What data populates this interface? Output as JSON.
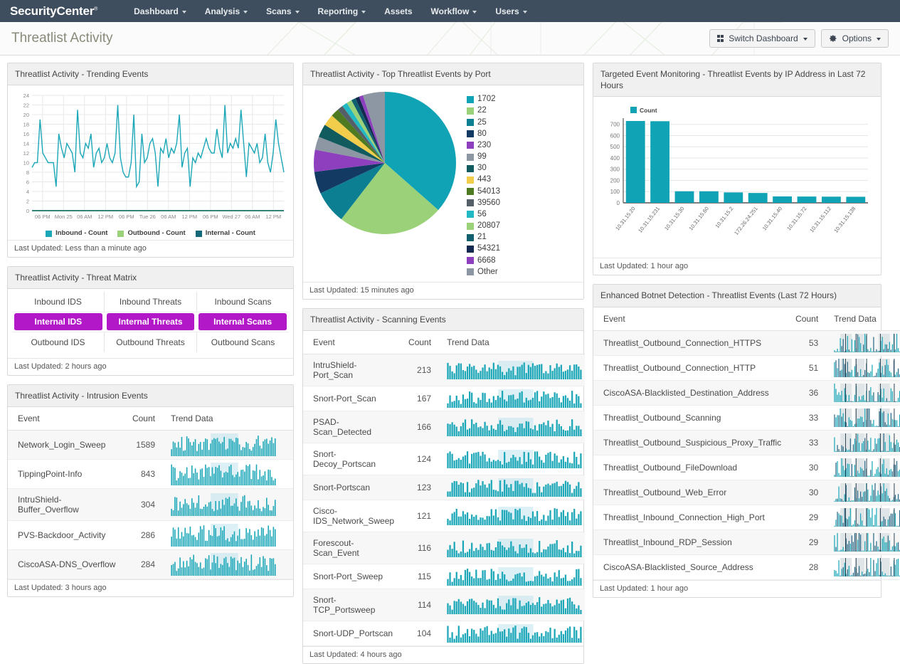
{
  "navbar": {
    "brand": "SecurityCenter",
    "items": [
      {
        "label": "Dashboard",
        "caret": true
      },
      {
        "label": "Analysis",
        "caret": true
      },
      {
        "label": "Scans",
        "caret": true
      },
      {
        "label": "Reporting",
        "caret": true
      },
      {
        "label": "Assets",
        "caret": false
      },
      {
        "label": "Workflow",
        "caret": true
      },
      {
        "label": "Users",
        "caret": true
      }
    ]
  },
  "titlebar": {
    "title": "Threatlist Activity",
    "switch_dashboard_label": "Switch Dashboard",
    "options_label": "Options"
  },
  "colors": {
    "navbar_bg": "#3f4e5e",
    "teal": "#1ba7b8",
    "teal_dark": "#0d7f93",
    "green": "#9bd179",
    "purple": "#b318c8",
    "highlight_band": "#bfe4ec"
  },
  "panels": {
    "trending": {
      "title": "Threatlist Activity - Trending Events",
      "footer": "Last Updated: Less than a minute ago"
    },
    "threat_matrix": {
      "title": "Threatlist Activity - Threat Matrix",
      "footer": "Last Updated: 2 hours ago",
      "rows": [
        [
          {
            "label": "Inbound IDS",
            "active": false
          },
          {
            "label": "Inbound Threats",
            "active": false
          },
          {
            "label": "Inbound Scans",
            "active": false
          }
        ],
        [
          {
            "label": "Internal IDS",
            "active": true
          },
          {
            "label": "Internal Threats",
            "active": true
          },
          {
            "label": "Internal Scans",
            "active": true
          }
        ],
        [
          {
            "label": "Outbound IDS",
            "active": false
          },
          {
            "label": "Outbound Threats",
            "active": false
          },
          {
            "label": "Outbound Scans",
            "active": false
          }
        ]
      ]
    },
    "intrusion": {
      "title": "Threatlist Activity - Intrusion Events",
      "footer": "Last Updated: 3 hours ago",
      "columns": [
        "Event",
        "Count",
        "Trend Data"
      ],
      "rows": [
        {
          "event": "Network_Login_Sweep",
          "count": "1589"
        },
        {
          "event": "TippingPoint-Info",
          "count": "843"
        },
        {
          "event": "IntruShield-Buffer_Overflow",
          "count": "304"
        },
        {
          "event": "PVS-Backdoor_Activity",
          "count": "286"
        },
        {
          "event": "CiscoASA-DNS_Overflow",
          "count": "284"
        }
      ]
    },
    "top_ports": {
      "title": "Threatlist Activity - Top Threatlist Events by Port",
      "footer": "Last Updated: 15 minutes ago"
    },
    "scanning": {
      "title": "Threatlist Activity - Scanning Events",
      "footer": "Last Updated: 4 hours ago",
      "columns": [
        "Event",
        "Count",
        "Trend Data"
      ],
      "rows": [
        {
          "event": "IntruShield-Port_Scan",
          "count": "213"
        },
        {
          "event": "Snort-Port_Scan",
          "count": "167"
        },
        {
          "event": "PSAD-Scan_Detected",
          "count": "166"
        },
        {
          "event": "Snort-Decoy_Portscan",
          "count": "124"
        },
        {
          "event": "Snort-Portscan",
          "count": "123"
        },
        {
          "event": "Cisco-IDS_Network_Sweep",
          "count": "121"
        },
        {
          "event": "Forescout-Scan_Event",
          "count": "116"
        },
        {
          "event": "Snort-Port_Sweep",
          "count": "115"
        },
        {
          "event": "Snort-TCP_Portsweep",
          "count": "114"
        },
        {
          "event": "Snort-UDP_Portscan",
          "count": "104"
        }
      ]
    },
    "targeted": {
      "title": "Targeted Event Monitoring - Threatlist Events by IP Address in Last 72 Hours",
      "footer": "Last Updated: 1 hour ago"
    },
    "botnet": {
      "title": "Enhanced Botnet Detection - Threatlist Events (Last 72 Hours)",
      "footer": "Last Updated: 1 hour ago",
      "columns": [
        "Event",
        "Count",
        "Trend Data"
      ],
      "rows": [
        {
          "event": "Threatlist_Outbound_Connection_HTTPS",
          "count": "53"
        },
        {
          "event": "Threatlist_Outbound_Connection_HTTP",
          "count": "51"
        },
        {
          "event": "CiscoASA-Blacklisted_Destination_Address",
          "count": "36"
        },
        {
          "event": "Threatlist_Outbound_Scanning",
          "count": "33"
        },
        {
          "event": "Threatlist_Outbound_Suspicious_Proxy_Traffic",
          "count": "33"
        },
        {
          "event": "Threatlist_Outbound_FileDownload",
          "count": "30"
        },
        {
          "event": "Threatlist_Outbound_Web_Error",
          "count": "30"
        },
        {
          "event": "Threatlist_Inbound_Connection_High_Port",
          "count": "29"
        },
        {
          "event": "Threatlist_Inbound_RDP_Session",
          "count": "29"
        },
        {
          "event": "CiscoASA-Blacklisted_Source_Address",
          "count": "28"
        }
      ]
    }
  },
  "chart_data": [
    {
      "type": "line",
      "id": "trending-events",
      "title": "Threatlist Activity - Trending Events",
      "xlabel": "",
      "ylabel": "",
      "ylim": [
        0,
        24
      ],
      "yticks": [
        0,
        2,
        4,
        6,
        8,
        10,
        12,
        14,
        16,
        18,
        20,
        22,
        24
      ],
      "grid": true,
      "legend_position": "bottom",
      "xticks": [
        "06 PM",
        "Mon 25",
        "06 AM",
        "12 PM",
        "06 PM",
        "Tue 26",
        "06 AM",
        "12 PM",
        "06 PM",
        "Wed 27",
        "06 AM",
        "12 PM"
      ],
      "series": [
        {
          "name": "Inbound - Count",
          "color": "#1ba7b8",
          "values": [
            9,
            10,
            10,
            19,
            12,
            11,
            10,
            10,
            10,
            5,
            16,
            13,
            11,
            14,
            13,
            12,
            8,
            21,
            12,
            11,
            14,
            13,
            16,
            9,
            12,
            13,
            10,
            11,
            14,
            11,
            10,
            12,
            22,
            11,
            8,
            7,
            7,
            10,
            20,
            5,
            6,
            16,
            10,
            11,
            14,
            15,
            12,
            5,
            13,
            12,
            15,
            11,
            13,
            12,
            14,
            20,
            9,
            12,
            13,
            5,
            11,
            10,
            12,
            11,
            13,
            15,
            13,
            12,
            12,
            17,
            13,
            11,
            22,
            12,
            14,
            13,
            15,
            13,
            21,
            14,
            7,
            14,
            13,
            12,
            14,
            10,
            11,
            16,
            10,
            8,
            12,
            19,
            14,
            11,
            8
          ]
        },
        {
          "name": "Outbound - Count",
          "color": "#9bd179",
          "values": [
            0,
            0,
            0,
            0,
            0,
            0,
            0,
            0,
            0,
            0,
            0,
            0,
            0,
            0,
            0,
            0,
            0,
            0,
            0,
            0,
            0,
            0,
            0,
            0,
            0,
            0,
            0,
            0,
            0,
            0,
            0,
            0,
            0,
            0,
            0,
            0,
            0,
            0,
            0,
            0,
            0,
            0,
            0,
            0,
            0,
            0,
            0,
            0,
            0,
            0,
            0,
            0,
            0,
            0,
            0,
            0,
            0,
            0,
            0,
            0,
            0,
            0,
            0,
            0,
            0,
            0,
            0,
            0,
            0,
            0,
            0,
            0,
            0,
            0,
            0,
            0,
            0,
            0,
            0,
            0,
            0,
            0,
            0,
            0,
            0,
            0,
            0,
            0,
            0,
            0,
            0,
            0,
            0,
            0,
            0
          ]
        },
        {
          "name": "Internal - Count",
          "color": "#13697a",
          "values": [
            0,
            0,
            0,
            0,
            0,
            0,
            0,
            0,
            0,
            0,
            0,
            0,
            0,
            0,
            0,
            0,
            0,
            0,
            0,
            0,
            0,
            0,
            0,
            0,
            0,
            0,
            0,
            0,
            0,
            0,
            0,
            0,
            0,
            0,
            0,
            0,
            0,
            0,
            0,
            0,
            0,
            0,
            0,
            0,
            0,
            0,
            0,
            0,
            0,
            0,
            0,
            0,
            0,
            0,
            0,
            0,
            0,
            0,
            0,
            0,
            0,
            0,
            0,
            0,
            0,
            0,
            0,
            0,
            0,
            0,
            0,
            0,
            0,
            0,
            0,
            0,
            0,
            0,
            0,
            0,
            0,
            0,
            0,
            0,
            0,
            0,
            0,
            0,
            0,
            0,
            0,
            0,
            0,
            0,
            0
          ]
        }
      ]
    },
    {
      "type": "pie",
      "id": "top-threatlist-events-by-port",
      "title": "Threatlist Activity - Top Threatlist Events by Port",
      "legend_position": "right",
      "slices": [
        {
          "label": "1702",
          "value": 36.5,
          "color": "#10a3b5"
        },
        {
          "label": "22",
          "value": 24.0,
          "color": "#9bd179"
        },
        {
          "label": "25",
          "value": 7.5,
          "color": "#0d7f93"
        },
        {
          "label": "80",
          "value": 5.0,
          "color": "#123a63"
        },
        {
          "label": "230",
          "value": 5.0,
          "color": "#8e3fbe"
        },
        {
          "label": "99",
          "value": 3.0,
          "color": "#8c97a3"
        },
        {
          "label": "30",
          "value": 3.0,
          "color": "#115b5e"
        },
        {
          "label": "443",
          "value": 2.6,
          "color": "#f2cd4c"
        },
        {
          "label": "54013",
          "value": 1.9,
          "color": "#4e7a22"
        },
        {
          "label": "39560",
          "value": 1.3,
          "color": "#555f67"
        },
        {
          "label": "56",
          "value": 1.2,
          "color": "#22b8c4"
        },
        {
          "label": "20807",
          "value": 1.2,
          "color": "#9bd179"
        },
        {
          "label": "21",
          "value": 1.0,
          "color": "#0f5f6e"
        },
        {
          "label": "54321",
          "value": 0.9,
          "color": "#14294f"
        },
        {
          "label": "6668",
          "value": 0.9,
          "color": "#8e3fbe"
        },
        {
          "label": "Other",
          "value": 5.0,
          "color": "#8c97a3"
        }
      ]
    },
    {
      "type": "bar",
      "id": "threatlist-events-by-ip",
      "title": "Targeted Event Monitoring - Threatlist Events by IP Address in Last 72 Hours",
      "xlabel": "",
      "ylabel": "",
      "ylim": [
        0,
        700
      ],
      "yticks": [
        0,
        100,
        200,
        300,
        400,
        500,
        600,
        700
      ],
      "grid": true,
      "legend_position": "top-left",
      "series_name": "Count",
      "series_color": "#10a3b5",
      "categories": [
        "10.31.15.20",
        "10.31.15.231",
        "10.31.15.30",
        "10.31.15.60",
        "10.31.15.2",
        "172.26.24.251",
        "10.31.15.40",
        "10.31.15.72",
        "10.31.15.112",
        "10.31.15.138"
      ],
      "values": [
        730,
        728,
        103,
        103,
        93,
        88,
        57,
        56,
        55,
        54
      ]
    }
  ]
}
